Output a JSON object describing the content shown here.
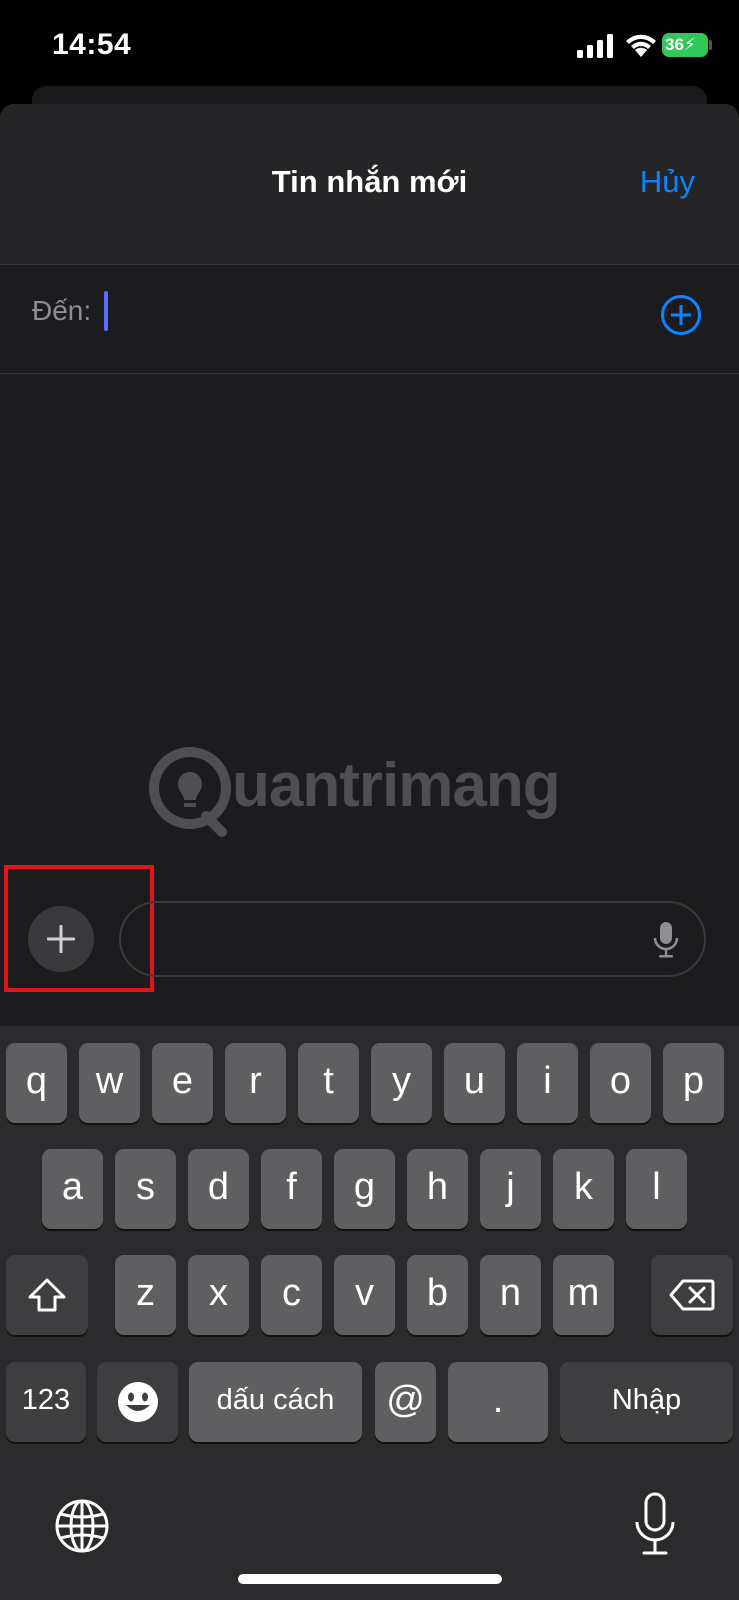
{
  "status_bar": {
    "time": "14:54",
    "battery": "36"
  },
  "header": {
    "title": "Tin nhắn mới",
    "cancel_label": "Hủy"
  },
  "recipient": {
    "label": "Đến:"
  },
  "watermark": {
    "text": "uantrimang"
  },
  "keyboard": {
    "row1": [
      "q",
      "w",
      "e",
      "r",
      "t",
      "y",
      "u",
      "i",
      "o",
      "p"
    ],
    "row2": [
      "a",
      "s",
      "d",
      "f",
      "g",
      "h",
      "j",
      "k",
      "l"
    ],
    "row3": [
      "z",
      "x",
      "c",
      "v",
      "b",
      "n",
      "m"
    ],
    "numbers_label": "123",
    "at_label": "@",
    "period_label": ".",
    "space_label": "dấu cách",
    "return_label": "Nhập"
  },
  "colors": {
    "accent": "#0a84ff",
    "highlight": "#e3141a",
    "battery": "#32c759"
  }
}
